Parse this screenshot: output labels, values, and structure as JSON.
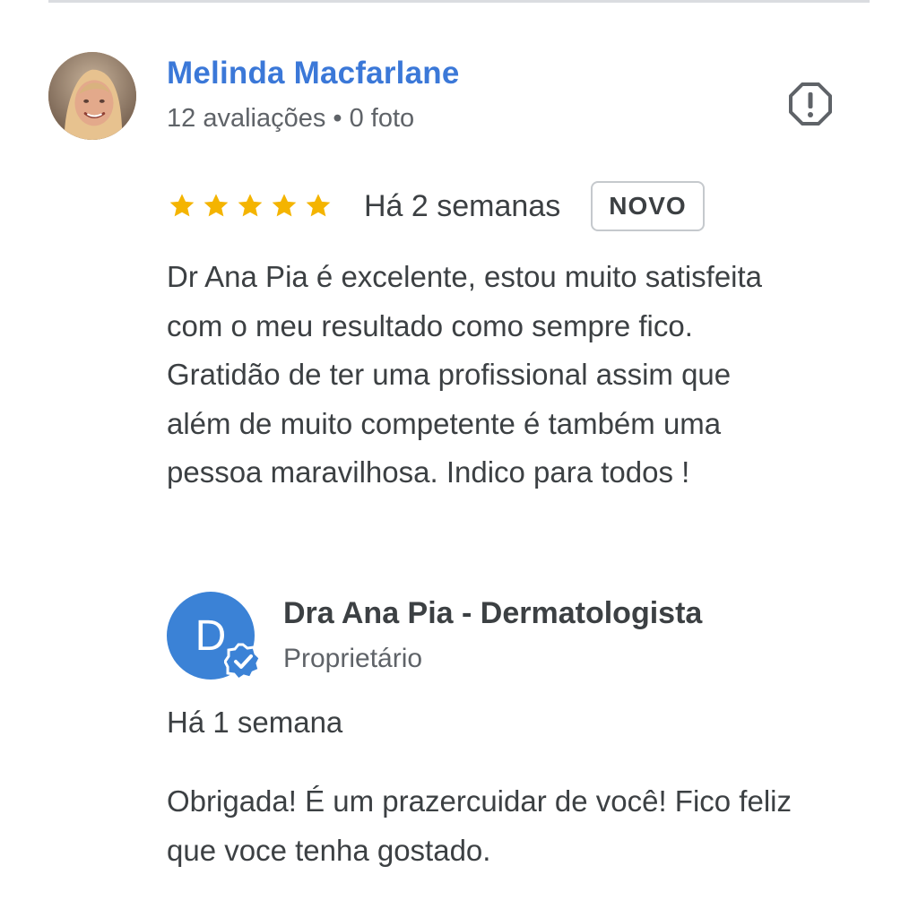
{
  "review": {
    "reviewer_name": "Melinda Macfarlane",
    "reviewer_meta": "12 avaliações • 0 foto",
    "rating": 5,
    "rating_max": 5,
    "date": "Há 2 semanas",
    "badge": "NOVO",
    "text": "Dr Ana Pia é excelente, estou muito satisfeita com o meu resultado como sempre fico. Gratidão de ter uma profissional assim que além de muito competente é também uma pessoa maravilhosa. Indico para todos !",
    "icons": {
      "avatar": "user-avatar",
      "report": "report-icon",
      "star": "star-icon"
    }
  },
  "reply": {
    "avatar_letter": "D",
    "owner_name": "Dra Ana Pia - Dermatologista",
    "role": "Proprietário",
    "date": "Há 1 semana",
    "text": "Obrigada! É um prazercuidar de você! Fico feliz que voce tenha gostado.",
    "icons": {
      "verified": "verified-badge-icon"
    }
  },
  "colors": {
    "name_link": "#3b78d8",
    "star": "#f4b400",
    "owner_avatar": "#3b82d6",
    "text": "#3c4043",
    "muted": "#5f6368"
  }
}
